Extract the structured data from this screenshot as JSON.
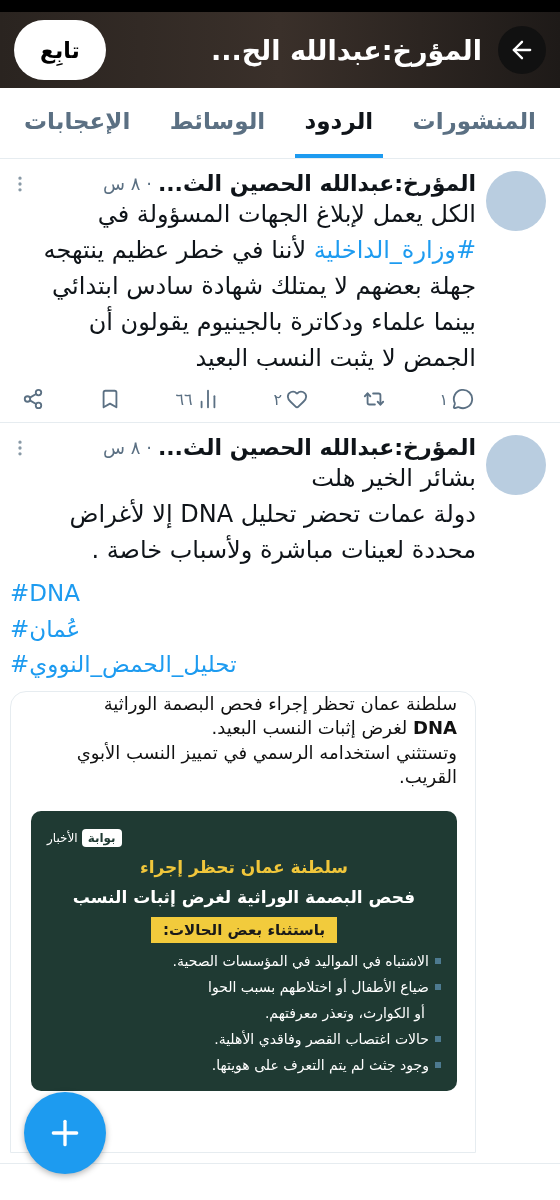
{
  "header": {
    "title": "المؤرخ:عبدالله الح...",
    "follow_button": "تابِع"
  },
  "tabs": [
    {
      "label": "المنشورات",
      "selected": false
    },
    {
      "label": "الردود",
      "selected": true
    },
    {
      "label": "الوسائط",
      "selected": false
    },
    {
      "label": "الإعجابات",
      "selected": false
    }
  ],
  "posts": [
    {
      "author": "المؤرخ:عبدالله الحصين الث...",
      "time": "· ٨ س",
      "body": [
        {
          "kind": "text",
          "text": "الكل يعمل لإبلاغ الجهات المسؤولة في "
        },
        {
          "kind": "hashtag",
          "text": "#وزارة_الداخلية"
        },
        {
          "kind": "text",
          "text": "  لأننا في خطر عظيم ينتهجه جهلة بعضهم لا يمتلك  شهادة سادس ابتدائي بينما علماء ودكاترة بالجينيوم  يقولون أن  الجمض لا يثبت النسب البعيد"
        }
      ],
      "stats": [
        {
          "kind": "reply",
          "count": "١"
        },
        {
          "kind": "repost"
        },
        {
          "kind": "like",
          "count": "٢"
        },
        {
          "kind": "views",
          "count": "٦٦"
        },
        {
          "kind": "bookmark"
        },
        {
          "kind": "share"
        }
      ]
    },
    {
      "author": "المؤرخ:عبدالله الحصين الث...",
      "time": "· ٨ س",
      "lines": [
        "بشائر الخير هلت",
        "دولة عمات تحضر تحليل DNA إلا لأغراض محددة لعينات مباشرة ولأسباب خاصة ."
      ],
      "hashtags": [
        "#DNA",
        "#عُمان",
        "#تحليل_الحمض_النووي"
      ],
      "media": {
        "lines": [
          "سلطنة عمان تحظر إجراء فحص البصمة الوراثية",
          "**DNA** لغرض إثبات النسب البعيد.",
          "وتستثني استخدامه الرسمي في تمييز النسب الأبوي القريب."
        ],
        "poster": {
          "logo": "بوابة",
          "logo_word": "الأخبار",
          "title": "سلطنة عمان تحظر إجراء",
          "subtitle": "فحص البصمة الوراثية لغرض إثبات النسب",
          "band": "باستثناء بعض الحالات:",
          "items": [
            "الاشتباه في المواليد في المؤسسات الصحية.",
            "ضياع الأطفال أو اختلاطهم بسبب الحوا",
            "أو الكوارث، وتعذر معرفتهم.",
            "حالات اغتصاب القصر وفاقدي الأهلية.",
            "وجود جثث لم يتم التعرف على هويتها."
          ]
        }
      }
    }
  ]
}
